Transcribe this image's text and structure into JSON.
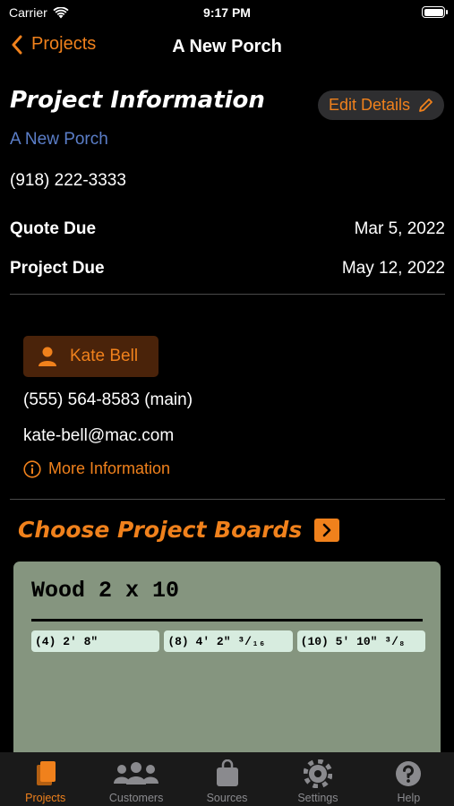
{
  "status_bar": {
    "carrier": "Carrier",
    "time": "9:17 PM"
  },
  "nav": {
    "back_label": "Projects",
    "title": "A New Porch"
  },
  "project": {
    "section_title": "Project Information",
    "edit_label": "Edit Details",
    "name": "A New Porch",
    "phone": "(918) 222-3333",
    "quote_due_label": "Quote Due",
    "quote_due_value": "Mar 5, 2022",
    "project_due_label": "Project Due",
    "project_due_value": "May 12, 2022"
  },
  "customer": {
    "name": "Kate Bell",
    "phone": "(555) 564-8583 (main)",
    "email": "kate-bell@mac.com",
    "more_info_label": "More Information"
  },
  "boards": {
    "section_title": "Choose Project Boards",
    "items": [
      {
        "name": "Wood 2 x 10",
        "pieces": [
          "(4) 2′ 8″",
          "(8) 4′ 2″ ³/₁₆",
          "(10) 5′ 10″ ³/₈"
        ]
      }
    ]
  },
  "tabs": [
    {
      "label": "Projects",
      "icon": "projects-icon",
      "active": true
    },
    {
      "label": "Customers",
      "icon": "customers-icon",
      "active": false
    },
    {
      "label": "Sources",
      "icon": "sources-icon",
      "active": false
    },
    {
      "label": "Settings",
      "icon": "settings-icon",
      "active": false
    },
    {
      "label": "Help",
      "icon": "help-icon",
      "active": false
    }
  ],
  "colors": {
    "accent": "#f0811c",
    "link": "#5b7ec8",
    "board_bg": "#85957f",
    "piece_bg": "#d7ecdf"
  }
}
